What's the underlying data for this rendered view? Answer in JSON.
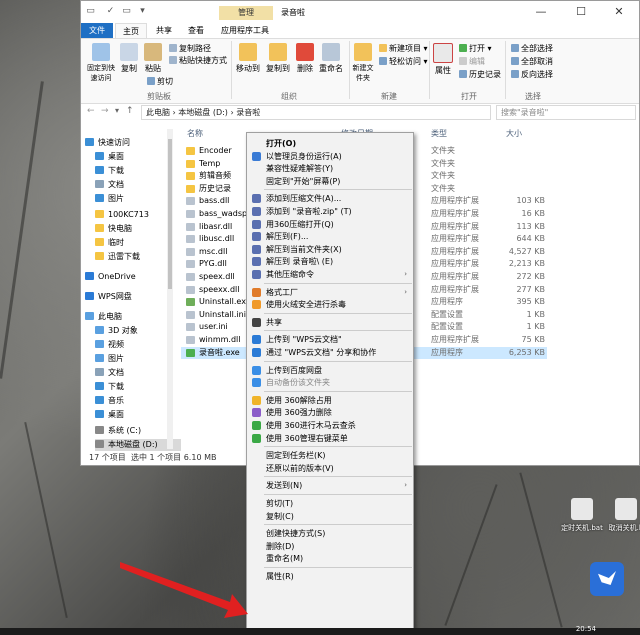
{
  "window": {
    "title": "录音啦",
    "manage_tab": "管理",
    "controls": {
      "minimize": "—",
      "maximize": "☐",
      "close": "✕"
    }
  },
  "ribbon_tabs": [
    "文件",
    "主页",
    "共享",
    "查看",
    "应用程序工具"
  ],
  "ribbon": {
    "groups": [
      "剪贴板",
      "组织",
      "新建",
      "打开",
      "选择"
    ],
    "pin": "固定到快速访问",
    "copy": "复制",
    "paste": "粘贴",
    "copy_path": "复制路径",
    "paste_shortcut": "粘贴快捷方式",
    "cut": "剪切",
    "move_to": "移动到",
    "copy_to": "复制到",
    "delete": "删除",
    "rename": "重命名",
    "new_folder": "新建文件夹",
    "new_item": "新建项目 ▾",
    "easy_access": "轻松访问 ▾",
    "properties": "属性",
    "open": "打开 ▾",
    "edit": "编辑",
    "history": "历史记录",
    "select_all": "全部选择",
    "select_none": "全部取消",
    "invert": "反向选择"
  },
  "address": {
    "path": "此电脑  ›  本地磁盘 (D:)  ›  录音啦",
    "search_placeholder": "搜索\"录音啦\""
  },
  "nav": [
    {
      "label": "快速访问",
      "color": "#3b8fd6"
    },
    {
      "label": "桌面",
      "color": "#3b8fd6"
    },
    {
      "label": "下载",
      "color": "#3b8fd6"
    },
    {
      "label": "文档",
      "color": "#8aa2b8"
    },
    {
      "label": "图片",
      "color": "#3b8fd6"
    },
    {
      "label": "100KC713",
      "color": "#f5c542"
    },
    {
      "label": "快电脑",
      "color": "#f5c542"
    },
    {
      "label": "临时",
      "color": "#f5c542"
    },
    {
      "label": "迅雷下载",
      "color": "#f5c542"
    },
    {
      "label": "OneDrive",
      "color": "#2b7bd6"
    },
    {
      "label": "WPS网盘",
      "color": "#2b7bd6"
    },
    {
      "label": "此电脑",
      "color": "#5aa0e0"
    },
    {
      "label": "3D 对象",
      "color": "#5aa0e0"
    },
    {
      "label": "视频",
      "color": "#5aa0e0"
    },
    {
      "label": "图片",
      "color": "#5aa0e0"
    },
    {
      "label": "文档",
      "color": "#8aa2b8"
    },
    {
      "label": "下载",
      "color": "#3b8fd6"
    },
    {
      "label": "音乐",
      "color": "#3b8fd6"
    },
    {
      "label": "桌面",
      "color": "#3b8fd6"
    },
    {
      "label": "系统 (C:)",
      "color": "#888"
    },
    {
      "label": "本地磁盘 (D:)",
      "color": "#888"
    }
  ],
  "columns": {
    "name": "名称",
    "date": "修改日期",
    "type": "类型",
    "size": "大小"
  },
  "files": [
    {
      "name": "Encoder",
      "type": "文件夹",
      "size": "",
      "color": "#f5c542"
    },
    {
      "name": "Temp",
      "type": "文件夹",
      "size": "",
      "color": "#f5c542"
    },
    {
      "name": "剪辑音频",
      "type": "文件夹",
      "size": "",
      "color": "#f5c542"
    },
    {
      "name": "历史记录",
      "type": "文件夹",
      "size": "",
      "color": "#f5c542"
    },
    {
      "name": "bass.dll",
      "type": "应用程序扩展",
      "size": "103 KB",
      "color": "#b9c3cf"
    },
    {
      "name": "bass_wadsp.dll",
      "type": "应用程序扩展",
      "size": "16 KB",
      "color": "#b9c3cf"
    },
    {
      "name": "libasr.dll",
      "type": "应用程序扩展",
      "size": "113 KB",
      "color": "#b9c3cf"
    },
    {
      "name": "libusc.dll",
      "type": "应用程序扩展",
      "size": "644 KB",
      "color": "#b9c3cf"
    },
    {
      "name": "msc.dll",
      "type": "应用程序扩展",
      "size": "4,527 KB",
      "color": "#b9c3cf"
    },
    {
      "name": "PYG.dll",
      "type": "应用程序扩展",
      "size": "2,213 KB",
      "color": "#b9c3cf"
    },
    {
      "name": "speex.dll",
      "type": "应用程序扩展",
      "size": "272 KB",
      "color": "#b9c3cf"
    },
    {
      "name": "speexx.dll",
      "type": "应用程序扩展",
      "size": "277 KB",
      "color": "#b9c3cf"
    },
    {
      "name": "Uninstall.exe",
      "type": "应用程序",
      "size": "395 KB",
      "color": "#6fae5a"
    },
    {
      "name": "Uninstall.ini",
      "type": "配置设置",
      "size": "1 KB",
      "color": "#b9c3cf"
    },
    {
      "name": "user.ini",
      "type": "配置设置",
      "size": "1 KB",
      "color": "#b9c3cf"
    },
    {
      "name": "winmm.dll",
      "type": "应用程序扩展",
      "size": "75 KB",
      "color": "#b9c3cf"
    },
    {
      "name": "录音啦.exe",
      "type": "应用程序",
      "size": "6,253 KB",
      "color": "#4caf50"
    }
  ],
  "status": {
    "count": "17 个项目",
    "selected": "选中 1 个项目  6.10 MB"
  },
  "context_menu": [
    {
      "label": "打开(O)",
      "bold": true,
      "color": ""
    },
    {
      "label": "以管理员身份运行(A)",
      "color": "#3a7bd5"
    },
    {
      "label": "兼容性疑难解答(Y)",
      "color": ""
    },
    {
      "label": "固定到\"开始\"屏幕(P)",
      "color": ""
    },
    {
      "sep": true
    },
    {
      "label": "添加到压缩文件(A)...",
      "color": "#5a6fb0"
    },
    {
      "label": "添加到 \"录音啦.zip\" (T)",
      "color": "#5a6fb0"
    },
    {
      "label": "用360压缩打开(Q)",
      "color": "#5a6fb0"
    },
    {
      "label": "解压到(F)...",
      "color": "#5a6fb0"
    },
    {
      "label": "解压到当前文件夹(X)",
      "color": "#5a6fb0"
    },
    {
      "label": "解压到 录音啦\\ (E)",
      "color": "#5a6fb0"
    },
    {
      "label": "其他压缩命令",
      "color": "#5a6fb0",
      "submenu": true
    },
    {
      "sep": true
    },
    {
      "label": "格式工厂",
      "color": "#e07b2a",
      "submenu": true
    },
    {
      "label": "使用火绒安全进行杀毒",
      "color": "#f09a2a"
    },
    {
      "sep": true
    },
    {
      "label": "共享",
      "color": "#444"
    },
    {
      "sep": true
    },
    {
      "label": "上传到 \"WPS云文档\"",
      "color": "#2b7bd6"
    },
    {
      "label": "通过 \"WPS云文档\" 分享和协作",
      "color": "#2b7bd6"
    },
    {
      "sep": true
    },
    {
      "label": "上传到百度网盘",
      "color": "#3a8ee6"
    },
    {
      "label": "自动备份该文件夹",
      "color": "#3a8ee6",
      "dim": true
    },
    {
      "sep": true
    },
    {
      "label": "使用 360解除占用",
      "color": "#f0b429"
    },
    {
      "label": "使用 360强力删除",
      "color": "#8b5cc9"
    },
    {
      "label": "使用 360进行木马云查杀",
      "color": "#3aa845"
    },
    {
      "label": "使用 360管理右键菜单",
      "color": "#3aa845"
    },
    {
      "sep": true
    },
    {
      "label": "固定到任务栏(K)",
      "color": ""
    },
    {
      "label": "还原以前的版本(V)",
      "color": ""
    },
    {
      "sep": true
    },
    {
      "label": "发送到(N)",
      "color": "",
      "submenu": true
    },
    {
      "sep": true
    },
    {
      "label": "剪切(T)",
      "color": ""
    },
    {
      "label": "复制(C)",
      "color": ""
    },
    {
      "sep": true
    },
    {
      "label": "创建快捷方式(S)",
      "color": ""
    },
    {
      "label": "删除(D)",
      "color": ""
    },
    {
      "label": "重命名(M)",
      "color": ""
    },
    {
      "sep": true
    },
    {
      "label": "属性(R)",
      "color": ""
    }
  ],
  "desktop_icons": [
    "定时关机.bat",
    "取消关机.b"
  ],
  "taskbar_time": "20:54"
}
